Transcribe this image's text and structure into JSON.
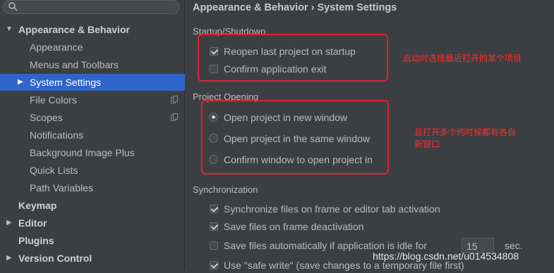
{
  "sidebar": {
    "search": {
      "placeholder": "",
      "value": ""
    },
    "items": [
      {
        "label": "Appearance & Behavior"
      },
      {
        "label": "Appearance"
      },
      {
        "label": "Menus and Toolbars"
      },
      {
        "label": "System Settings"
      },
      {
        "label": "File Colors"
      },
      {
        "label": "Scopes"
      },
      {
        "label": "Notifications"
      },
      {
        "label": "Background Image Plus"
      },
      {
        "label": "Quick Lists"
      },
      {
        "label": "Path Variables"
      },
      {
        "label": "Keymap"
      },
      {
        "label": "Editor"
      },
      {
        "label": "Plugins"
      },
      {
        "label": "Version Control"
      }
    ]
  },
  "main": {
    "breadcrumb": {
      "parent": "Appearance & Behavior",
      "separator": "›",
      "current": "System Settings"
    },
    "startup": {
      "title": "Startup/Shutdown",
      "reopen_label": "Reopen last project on startup",
      "confirm_exit_label": "Confirm application exit",
      "note": "启动时选择最近打开的某个项目"
    },
    "project_opening": {
      "title": "Project Opening",
      "options": [
        {
          "label": "Open project in new window"
        },
        {
          "label": "Open project in the same window"
        },
        {
          "label": "Confirm window to open project in"
        }
      ],
      "note_line1": "且打开多个的时候都有各自",
      "note_line2": "新窗口"
    },
    "sync": {
      "title": "Synchronization",
      "options": [
        {
          "label": "Synchronize files on frame or editor tab activation"
        },
        {
          "label": "Save files on frame deactivation"
        },
        {
          "label": "Save files automatically if application is idle for"
        },
        {
          "label": "Use \"safe write\" (save changes to a temporary file first)"
        }
      ],
      "idle_seconds": "15",
      "seconds_unit": "sec."
    }
  },
  "watermark": "https://blog.csdn.net/u014534808",
  "colors": {
    "selection": "#2f65ca",
    "annotation": "#e0203a"
  }
}
